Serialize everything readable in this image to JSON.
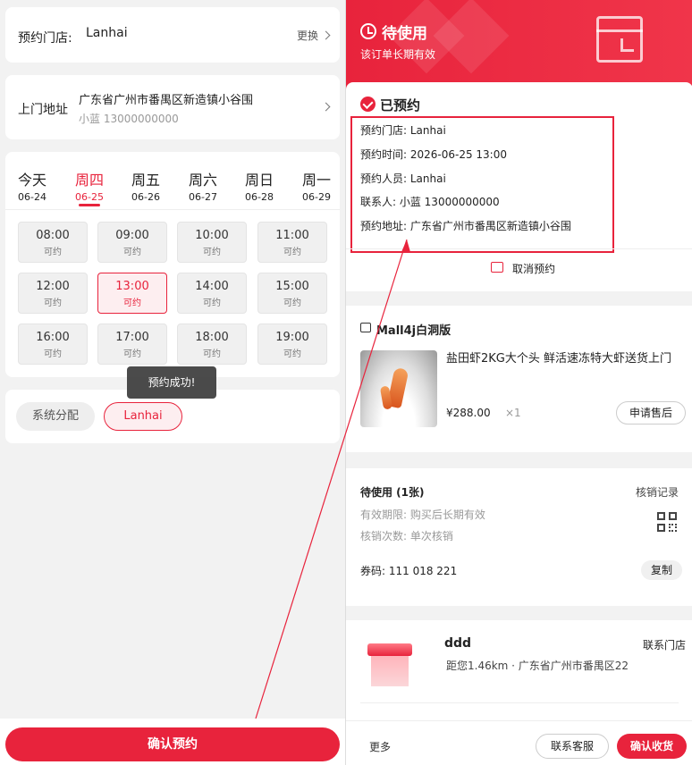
{
  "left": {
    "store": {
      "label": "预约门店:",
      "value": "Lanhai",
      "change": "更换"
    },
    "address": {
      "label": "上门地址",
      "line1": "广东省广州市番禺区新造镇小谷围",
      "line2": "小蓝 13000000000"
    },
    "days": [
      {
        "name": "今天",
        "date": "06-24"
      },
      {
        "name": "周四",
        "date": "06-25"
      },
      {
        "name": "周五",
        "date": "06-26"
      },
      {
        "name": "周六",
        "date": "06-27"
      },
      {
        "name": "周日",
        "date": "06-28"
      },
      {
        "name": "周一",
        "date": "06-29"
      }
    ],
    "slots": [
      {
        "time": "08:00",
        "status": "可约"
      },
      {
        "time": "09:00",
        "status": "可约"
      },
      {
        "time": "10:00",
        "status": "可约"
      },
      {
        "time": "11:00",
        "status": "可约"
      },
      {
        "time": "12:00",
        "status": "可约"
      },
      {
        "time": "13:00",
        "status": "可约"
      },
      {
        "time": "14:00",
        "status": "可约"
      },
      {
        "time": "15:00",
        "status": "可约"
      },
      {
        "time": "16:00",
        "status": "可约"
      },
      {
        "time": "17:00",
        "status": "可约"
      },
      {
        "time": "18:00",
        "status": "可约"
      },
      {
        "time": "19:00",
        "status": "可约"
      }
    ],
    "staff": {
      "system": "系统分配",
      "selected": "Lanhai"
    },
    "toast": "预约成功!",
    "confirm": "确认预约"
  },
  "right": {
    "hero": {
      "title": "待使用",
      "subtitle": "该订单长期有效"
    },
    "booking": {
      "title": "已预约",
      "rows": [
        "预约门店: Lanhai",
        "预约时间: 2026-06-25 13:00",
        "预约人员: Lanhai",
        "联系人: 小蓝 13000000000",
        "预约地址: 广东省广州市番禺区新造镇小谷围"
      ],
      "cancel": "取消预约"
    },
    "product": {
      "shop": "Mall4j白洞版",
      "name": "盐田虾2KG大个头 鲜活速冻特大虾送货上门",
      "price": "¥288.00",
      "qty": "×1",
      "after_sale": "申请售后"
    },
    "voucher": {
      "title": "待使用 (1张)",
      "records": "核销记录",
      "validity": "有效期限: 购买后长期有效",
      "times": "核销次数: 单次核销",
      "code": "券码:  111 018 221",
      "copy": "复制"
    },
    "store": {
      "name": "ddd",
      "contact": "联系门店",
      "location": "距您1.46km · 广东省广州市番禺区22"
    },
    "bottom": {
      "more": "更多",
      "service": "联系客服",
      "receive": "确认收货"
    }
  },
  "colors": {
    "accent": "#e8233c"
  }
}
